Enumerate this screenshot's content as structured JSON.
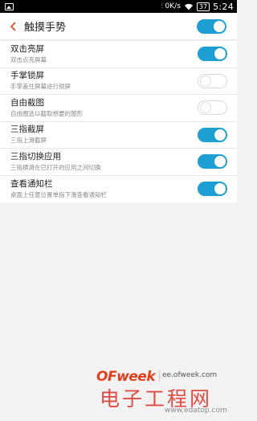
{
  "status_bar": {
    "time": "5:24",
    "battery": "37",
    "signal_text": "⫶ 0K/s",
    "icons": [
      "image-icon",
      "wifi-icon",
      "battery-icon"
    ]
  },
  "header": {
    "title": "触摸手势",
    "master_toggle": true
  },
  "colors": {
    "accent": "#1d9fd3",
    "back_arrow": "#e0401d",
    "watermark_red": "#d93025"
  },
  "settings": [
    {
      "title": "双击亮屏",
      "subtitle": "双击点亮屏幕",
      "enabled": true
    },
    {
      "title": "手掌锁屏",
      "subtitle": "手掌盖住屏幕进行锁屏",
      "enabled": false
    },
    {
      "title": "自由截图",
      "subtitle": "自由圈选以截取想要的图形",
      "enabled": false
    },
    {
      "title": "三指截屏",
      "subtitle": "三指上滑截屏",
      "enabled": true
    },
    {
      "title": "三指切换应用",
      "subtitle": "三指横滑在已打开的应用之间切换",
      "enabled": true
    },
    {
      "title": "查看通知栏",
      "subtitle": "桌面上任意位置单指下滑查看通知栏",
      "enabled": true
    }
  ],
  "watermark": {
    "logo": "OFweek",
    "url": "ee.ofweek.com",
    "cn": "电子工程网",
    "cn_url": "www.edatop.com"
  }
}
